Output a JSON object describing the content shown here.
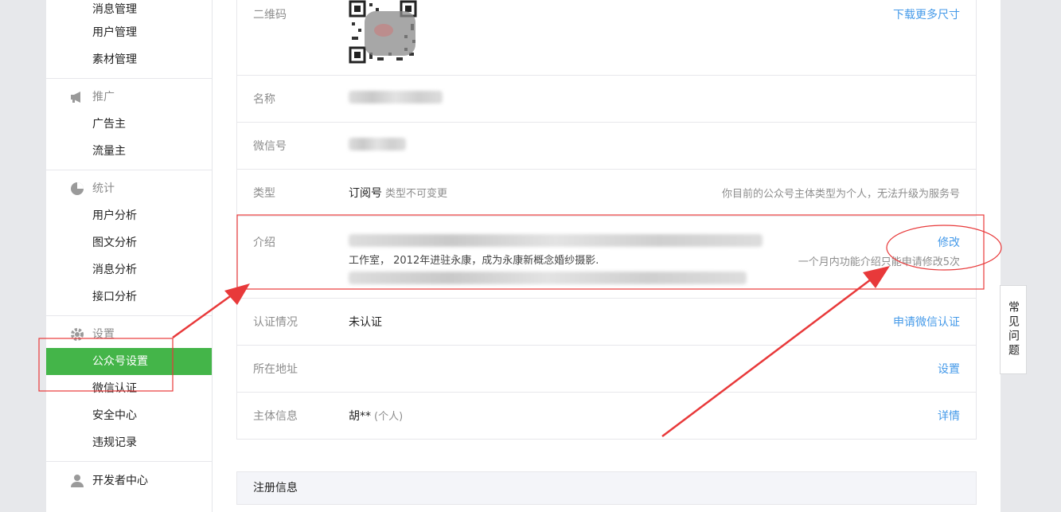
{
  "sidebar": {
    "top_items": [
      "消息管理",
      "用户管理",
      "素材管理"
    ],
    "promo": {
      "title": "推广",
      "items": [
        "广告主",
        "流量主"
      ]
    },
    "stats": {
      "title": "统计",
      "items": [
        "用户分析",
        "图文分析",
        "消息分析",
        "接口分析"
      ]
    },
    "settings": {
      "title": "设置",
      "items": [
        "公众号设置",
        "微信认证",
        "安全中心",
        "违规记录"
      ]
    },
    "developer": "开发者中心"
  },
  "info": {
    "qr": {
      "label": "二维码",
      "action": "下载更多尺寸"
    },
    "name": {
      "label": "名称"
    },
    "wechat_id": {
      "label": "微信号"
    },
    "type": {
      "label": "类型",
      "value": "订阅号",
      "sub": "类型不可变更",
      "note": "你目前的公众号主体类型为个人，无法升级为服务号"
    },
    "intro": {
      "label": "介绍",
      "visible_text": "工作室， 2012年进驻永康，成为永康新概念婚纱摄影.",
      "action": "修改",
      "note": "一个月内功能介绍只能申请修改5次"
    },
    "verify": {
      "label": "认证情况",
      "value": "未认证",
      "action": "申请微信认证"
    },
    "address": {
      "label": "所在地址",
      "action": "设置"
    },
    "entity": {
      "label": "主体信息",
      "value": "胡**",
      "sub": "(个人)",
      "action": "详情"
    }
  },
  "register_section": "注册信息",
  "faq_tab": "常见问题",
  "colors": {
    "accent_green": "#44b549",
    "link_blue": "#459ae9",
    "annotation_red": "#e8393a"
  }
}
